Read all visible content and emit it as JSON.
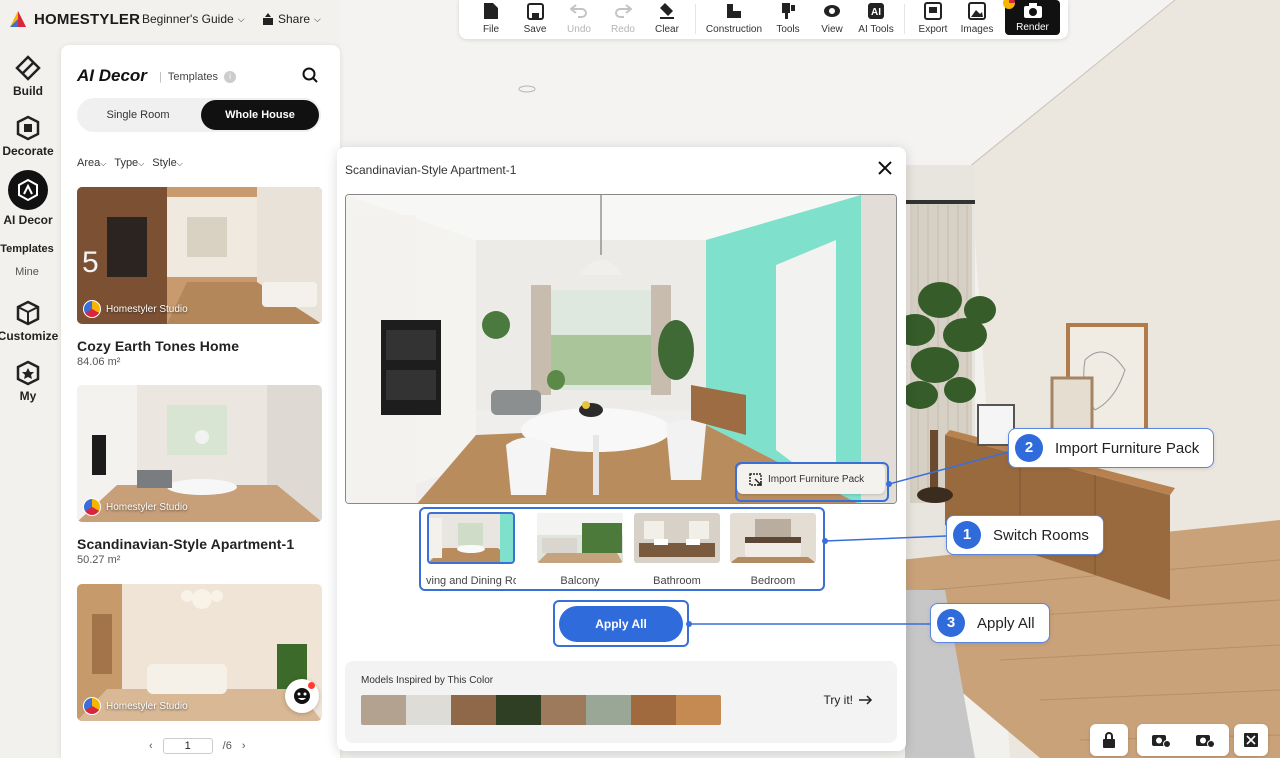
{
  "brand": {
    "name": "HOMESTYLER"
  },
  "top_menu": {
    "guide": "Beginner's Guide",
    "share": "Share"
  },
  "toolbar": {
    "file": "File",
    "save": "Save",
    "undo": "Undo",
    "redo": "Redo",
    "clear": "Clear",
    "construction": "Construction",
    "tools": "Tools",
    "view": "View",
    "ai_tools": "AI Tools",
    "export": "Export",
    "images": "Images",
    "render": "Render"
  },
  "rail": {
    "build": "Build",
    "decorate": "Decorate",
    "ai_decor": "AI Decor",
    "templates": "Templates",
    "mine": "Mine",
    "customize": "Customize",
    "my": "My"
  },
  "panel": {
    "title": "AI Decor",
    "subtitle": "Templates",
    "tabs": {
      "single": "Single Room",
      "whole": "Whole House"
    },
    "filters": {
      "area": "Area",
      "type": "Type",
      "style": "Style"
    },
    "badge": "Homestyler Studio",
    "cards": [
      {
        "title": "Cozy Earth Tones Home",
        "area": "84.06 m²"
      },
      {
        "title": "Scandinavian-Style Apartment-1",
        "area": "50.27 m²"
      }
    ],
    "pager": {
      "current": "1",
      "total": "/6"
    }
  },
  "dialog": {
    "title": "Scandinavian-Style Apartment-1",
    "import_label": "Import Furniture Pack",
    "rooms": [
      "ving and Dining Room",
      "Balcony",
      "Bathroom",
      "Bedroom"
    ],
    "apply_label": "Apply All",
    "palette_title": "Models Inspired by This Color",
    "palette": [
      "#b3a28f",
      "#dedcd7",
      "#8e6849",
      "#2f3f23",
      "#9e7a5d",
      "#9aa796",
      "#a06a3e",
      "#c48a52"
    ],
    "try_label": "Try it!"
  },
  "callouts": {
    "one": {
      "num": "1",
      "text": "Switch Rooms"
    },
    "two": {
      "num": "2",
      "text": "Import Furniture Pack"
    },
    "three": {
      "num": "3",
      "text": "Apply All"
    }
  },
  "colors": {
    "accent": "#2f6bdb",
    "dark": "#111111"
  }
}
